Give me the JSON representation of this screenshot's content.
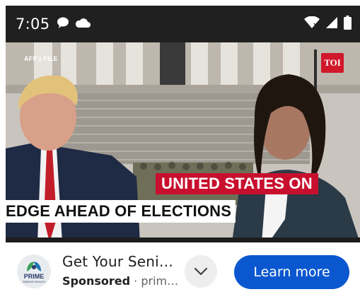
{
  "status_bar": {
    "time": "7:05",
    "left_icons": [
      "chat-bubble-icon",
      "cloud-icon"
    ],
    "right_icons": [
      "wifi-icon",
      "signal-icon",
      "battery-icon"
    ]
  },
  "video": {
    "source_tag": "AFP | FILE",
    "channel_logo": "TOI",
    "headline_line1": "UNITED STATES ON",
    "headline_line2": "EDGE AHEAD OF ELECTIONS",
    "colors": {
      "banner_red": "#c8102e",
      "logo_red": "#d0182a"
    }
  },
  "ad": {
    "advertiser_logo_text": "PRIME",
    "advertiser_logo_subtext": "SENIOR HEALTH",
    "title": "Get Your Senior Benefits",
    "sponsored_label": "Sponsored",
    "separator": " · ",
    "advertiser": "primeseniorhealth",
    "cta_label": "Learn more",
    "colors": {
      "cta": "#0b57d0"
    }
  }
}
